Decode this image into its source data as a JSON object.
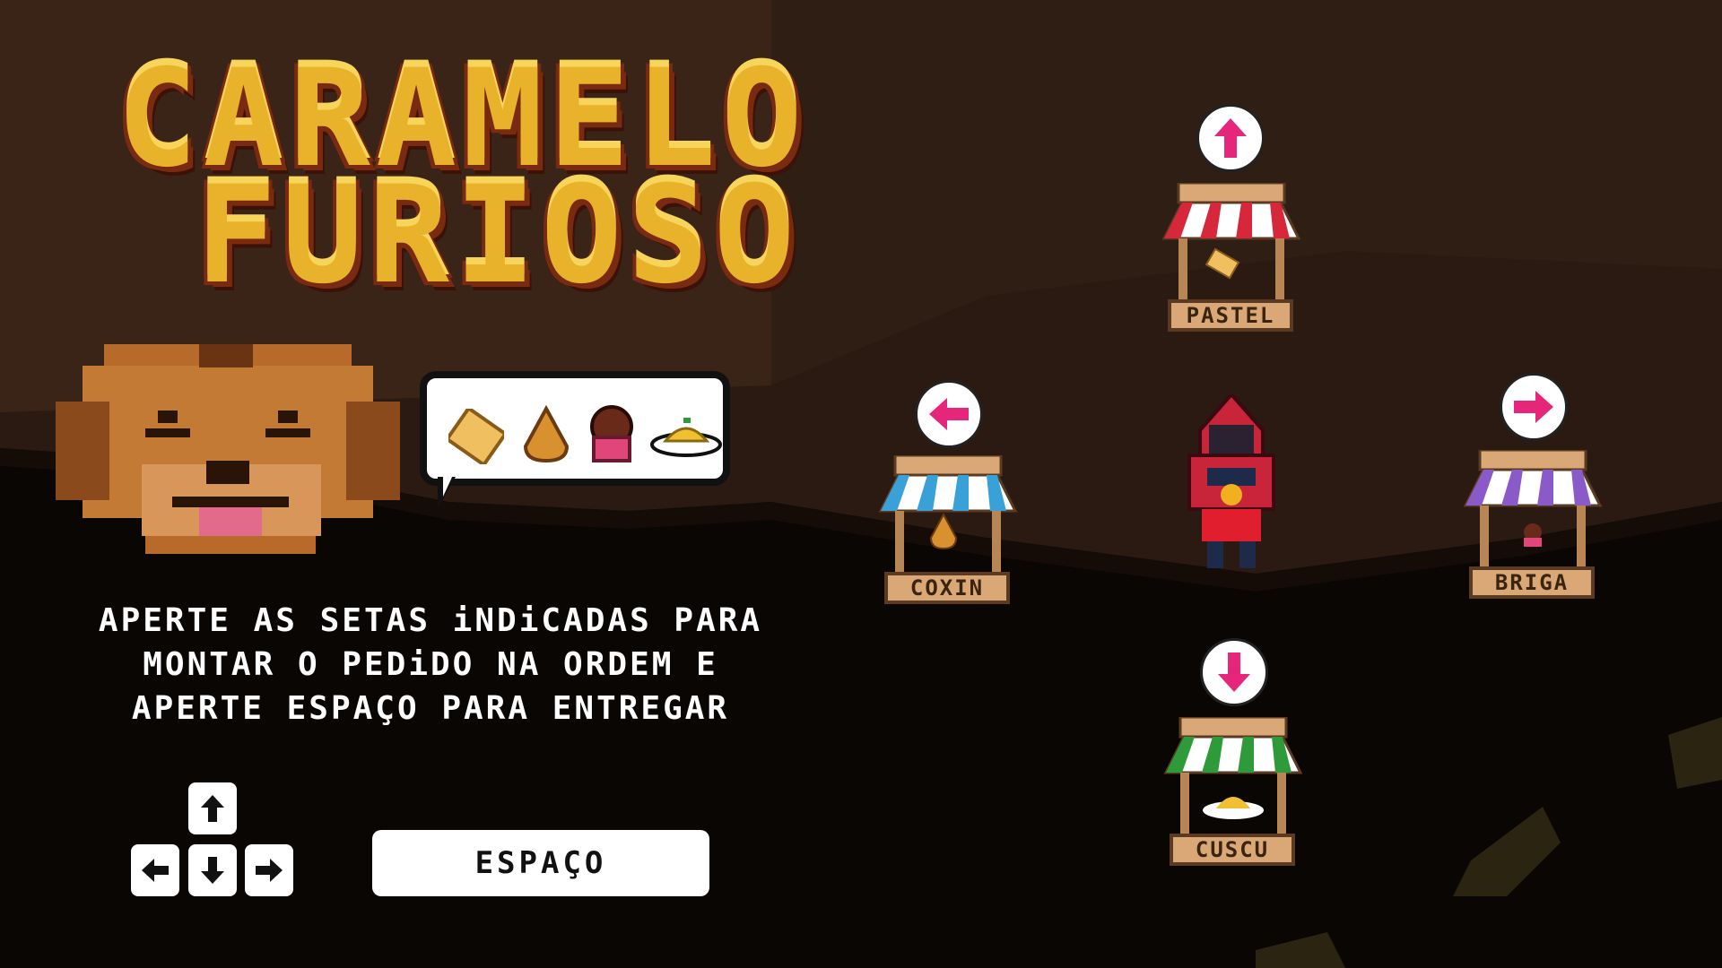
{
  "game": {
    "title_line1": "CARAMELO",
    "title_line2": "FURIOSO"
  },
  "instructions": {
    "line1": "APERTE AS SETAS iNDiCADAS PARA",
    "line2": "MONTAR O PEDiDO NA ORDEM E",
    "line3": "APERTE ESPAÇO PARA ENTREGAR"
  },
  "controls": {
    "space_label": "ESPAÇO",
    "arrow_keys": [
      "up",
      "left",
      "down",
      "right"
    ]
  },
  "order_bubble": {
    "items": [
      "pastel",
      "coxinha",
      "brigadeiro",
      "cuscuz"
    ]
  },
  "stalls": [
    {
      "id": "up",
      "label": "PASTEL",
      "awning_color": "#d6283a",
      "arrow": "up",
      "food": "pastel"
    },
    {
      "id": "left",
      "label": "COXIN",
      "awning_color": "#3aa0d8",
      "arrow": "left",
      "food": "coxinha"
    },
    {
      "id": "right",
      "label": "BRIGA",
      "awning_color": "#8a5ac8",
      "arrow": "right",
      "food": "brigadeiro"
    },
    {
      "id": "down",
      "label": "CUSCU",
      "awning_color": "#2e9a3a",
      "arrow": "down",
      "food": "cuscuz"
    }
  ],
  "colors": {
    "arrow_pink": "#e6267a",
    "title_gold": "#e8b22a",
    "dog_brown": "#b86a2a"
  }
}
